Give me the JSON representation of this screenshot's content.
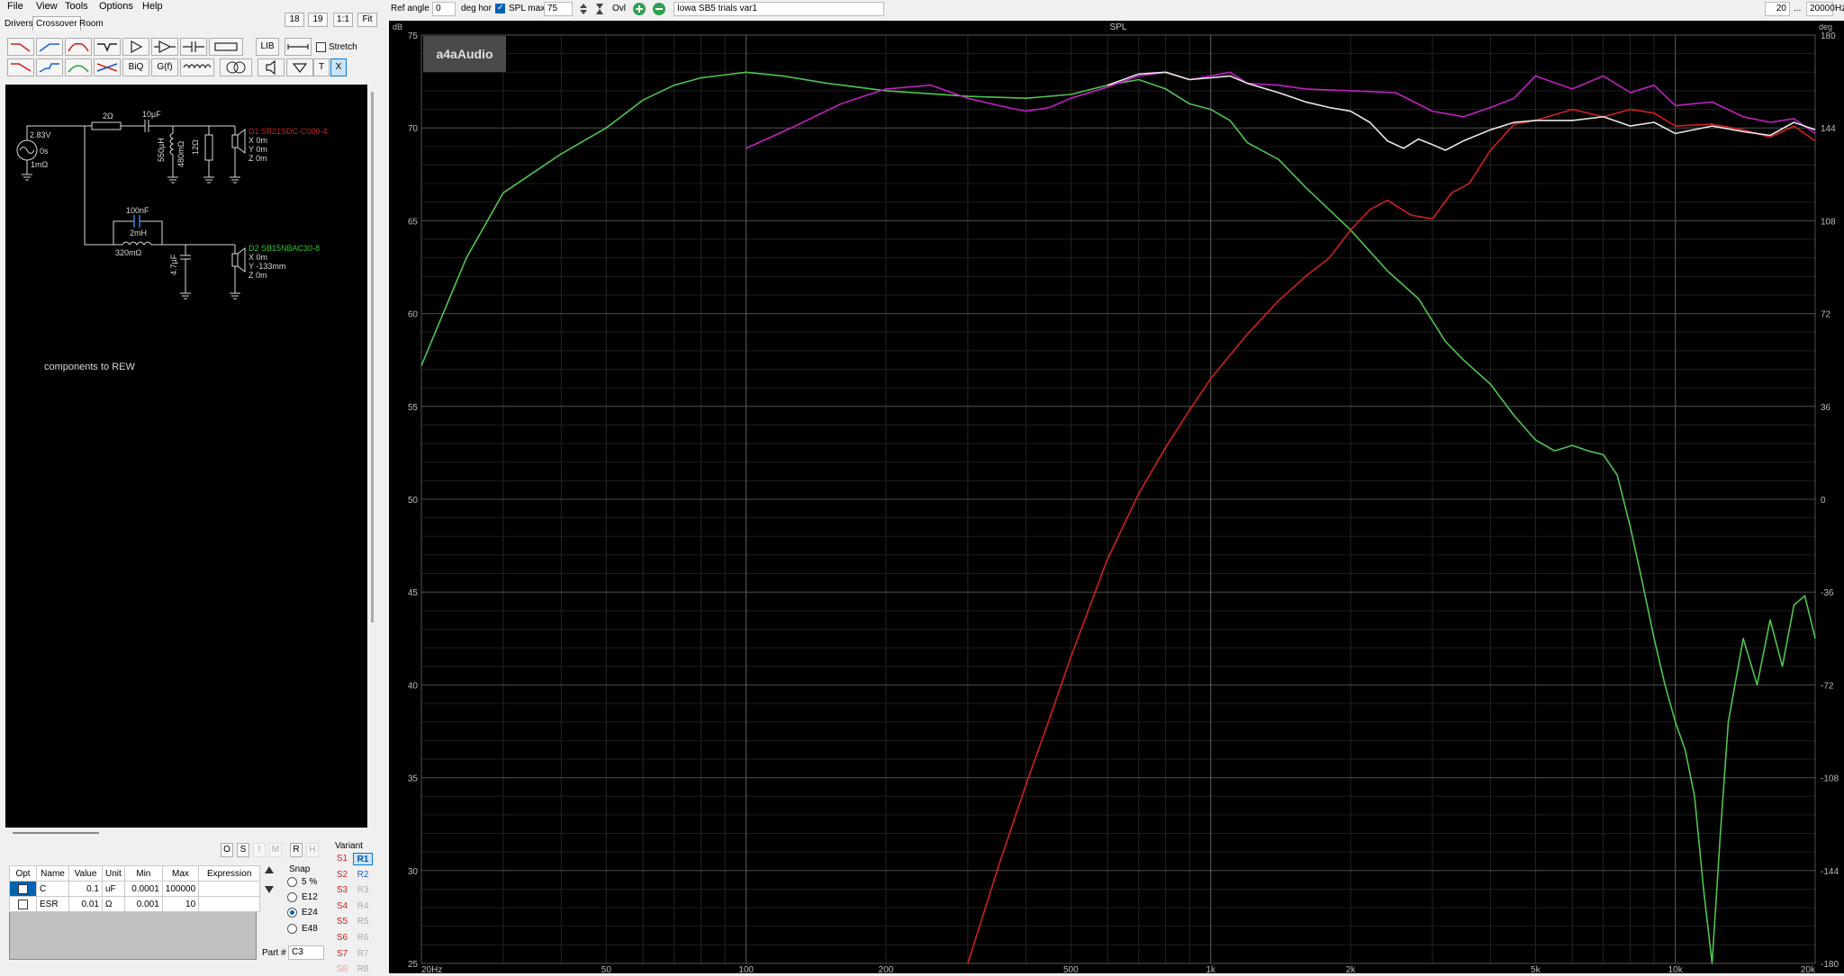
{
  "menu": [
    "File",
    "View",
    "Tools",
    "Options",
    "Help"
  ],
  "tabs": [
    "Drivers",
    "Crossover",
    "Room"
  ],
  "view_buttons": [
    "18",
    "19",
    "1:1",
    "Fit"
  ],
  "toolbar": {
    "lib": "LIB",
    "biq": "BiQ",
    "gf": "G(f)",
    "t": "T",
    "x": "X",
    "stretch_label": "Stretch"
  },
  "schematic": {
    "source_voltage": "2.83V",
    "source_delay": "0s",
    "source_resistance": "1mΩ",
    "r_series": "2Ω",
    "c_series": "10µF",
    "l_shunt": "550µH",
    "l_shunt_res": "480mΩ",
    "r_shunt": "12Ω",
    "d1_name": "D1 SB21SDC-C000-4",
    "d1_x": "X 0m",
    "d1_y": "Y 0m",
    "d1_z": "Z 0m",
    "c_parallel": "100nF",
    "l_series2": "2mH",
    "l_series2_res": "320mΩ",
    "c_shunt2": "4.7µF",
    "d2_name": "D2 SB15NBAC30-8",
    "d2_x": "X 0m",
    "d2_y": "Y -133mm",
    "d2_z": "Z 0m",
    "note": "components to REW"
  },
  "ops_buttons": [
    "O",
    "S",
    "I",
    "M",
    "R",
    "H"
  ],
  "parts_table": {
    "headers": [
      "Opt",
      "Name",
      "Value",
      "Unit",
      "Min",
      "Max",
      "Expression"
    ],
    "rows": [
      {
        "name": "C",
        "value": "0.1",
        "unit": "uF",
        "min": "0.0001",
        "max": "100000",
        "expr": ""
      },
      {
        "name": "ESR",
        "value": "0.01",
        "unit": "Ω",
        "min": "0.001",
        "max": "10",
        "expr": ""
      }
    ]
  },
  "snap": {
    "label": "Snap",
    "options": [
      "5 %",
      "E12",
      "E24",
      "E48"
    ],
    "selected": "E24"
  },
  "part_label": "Part #",
  "part_value": "C3",
  "variant": {
    "label": "Variant",
    "s": [
      "S1",
      "S2",
      "S3",
      "S4",
      "S5",
      "S6",
      "S7",
      "S8"
    ],
    "r": [
      "R1",
      "R2",
      "R3",
      "R4",
      "R5",
      "R6",
      "R7",
      "R8"
    ]
  },
  "topbar": {
    "ref_angle_label": "Ref angle",
    "ref_angle_value": "0",
    "deg_hor": "deg hor",
    "spl_max_label": "SPL max",
    "spl_max_value": "75",
    "ovl": "Ovl",
    "project_name": "Iowa SB5 trials var1",
    "f_min": "20",
    "ellipsis": "...",
    "f_max": "20000",
    "hz": "Hz"
  },
  "colors": {
    "green": "#4fc44f",
    "red": "#d21f1f",
    "magenta": "#c31fc3",
    "white": "#e8e8e8",
    "grid": "#3a3a3a"
  },
  "chart_data": {
    "type": "line",
    "title": "SPL",
    "xlabel": "",
    "ylabel": "dB",
    "y2label": "deg",
    "x_scale": "log",
    "xlim": [
      20,
      20000
    ],
    "ylim": [
      25,
      75
    ],
    "y2lim": [
      -180,
      180
    ],
    "x_ticks": [
      {
        "v": 20,
        "label": "20Hz"
      },
      {
        "v": 50,
        "label": "50"
      },
      {
        "v": 100,
        "label": "100"
      },
      {
        "v": 200,
        "label": "200"
      },
      {
        "v": 500,
        "label": "500"
      },
      {
        "v": 1000,
        "label": "1k"
      },
      {
        "v": 2000,
        "label": "2k"
      },
      {
        "v": 5000,
        "label": "5k"
      },
      {
        "v": 10000,
        "label": "10k"
      },
      {
        "v": 20000,
        "label": "20k"
      }
    ],
    "y_ticks": [
      25,
      30,
      35,
      40,
      45,
      50,
      55,
      60,
      65,
      70,
      75
    ],
    "y2_ticks": [
      -180,
      -144,
      -108,
      -72,
      -36,
      0,
      36,
      72,
      108,
      144,
      180
    ],
    "grid": true,
    "logo": "a4aAudio",
    "series": [
      {
        "color": "#4fc44f",
        "points": [
          [
            20,
            57.2
          ],
          [
            25,
            63
          ],
          [
            30,
            66.5
          ],
          [
            40,
            68.6
          ],
          [
            50,
            70
          ],
          [
            60,
            71.5
          ],
          [
            70,
            72.3
          ],
          [
            80,
            72.7
          ],
          [
            100,
            73
          ],
          [
            120,
            72.8
          ],
          [
            150,
            72.4
          ],
          [
            200,
            72
          ],
          [
            300,
            71.7
          ],
          [
            400,
            71.6
          ],
          [
            500,
            71.8
          ],
          [
            600,
            72.3
          ],
          [
            700,
            72.6
          ],
          [
            800,
            72.1
          ],
          [
            900,
            71.3
          ],
          [
            1000,
            71
          ],
          [
            1100,
            70.4
          ],
          [
            1200,
            69.2
          ],
          [
            1400,
            68.3
          ],
          [
            1600,
            66.8
          ],
          [
            2000,
            64.5
          ],
          [
            2400,
            62.3
          ],
          [
            2800,
            60.8
          ],
          [
            3200,
            58.5
          ],
          [
            3500,
            57.5
          ],
          [
            4000,
            56.2
          ],
          [
            4500,
            54.5
          ],
          [
            5000,
            53.2
          ],
          [
            5500,
            52.6
          ],
          [
            6000,
            52.9
          ],
          [
            6500,
            52.6
          ],
          [
            7000,
            52.4
          ],
          [
            7500,
            51.3
          ],
          [
            8000,
            48.5
          ],
          [
            8500,
            45.5
          ],
          [
            9000,
            42.5
          ],
          [
            9500,
            40
          ],
          [
            10000,
            38
          ],
          [
            10500,
            36.5
          ],
          [
            11000,
            34
          ],
          [
            11500,
            29
          ],
          [
            12000,
            25
          ],
          [
            12500,
            32
          ],
          [
            13000,
            38
          ],
          [
            14000,
            42.5
          ],
          [
            15000,
            40
          ],
          [
            16000,
            43.5
          ],
          [
            17000,
            41
          ],
          [
            18000,
            44.3
          ],
          [
            19000,
            44.8
          ],
          [
            20000,
            42.5
          ]
        ]
      },
      {
        "color": "#d21f1f",
        "points": [
          [
            300,
            25
          ],
          [
            350,
            30.3
          ],
          [
            400,
            34.6
          ],
          [
            450,
            38.2
          ],
          [
            500,
            41.5
          ],
          [
            600,
            46.8
          ],
          [
            700,
            50.3
          ],
          [
            800,
            52.8
          ],
          [
            900,
            54.8
          ],
          [
            1000,
            56.5
          ],
          [
            1200,
            58.9
          ],
          [
            1400,
            60.7
          ],
          [
            1600,
            62
          ],
          [
            1800,
            63
          ],
          [
            2000,
            64.5
          ],
          [
            2200,
            65.6
          ],
          [
            2400,
            66.1
          ],
          [
            2700,
            65.3
          ],
          [
            3000,
            65.1
          ],
          [
            3300,
            66.5
          ],
          [
            3600,
            67
          ],
          [
            4000,
            68.8
          ],
          [
            4500,
            70.2
          ],
          [
            5000,
            70.4
          ],
          [
            6000,
            71
          ],
          [
            7000,
            70.6
          ],
          [
            8000,
            71
          ],
          [
            9000,
            70.8
          ],
          [
            10000,
            70.1
          ],
          [
            12000,
            70.2
          ],
          [
            14000,
            69.9
          ],
          [
            16000,
            69.5
          ],
          [
            18000,
            70.1
          ],
          [
            20000,
            69.3
          ]
        ]
      },
      {
        "color": "#c31fc3",
        "points": [
          [
            100,
            68.9
          ],
          [
            130,
            70.2
          ],
          [
            160,
            71.3
          ],
          [
            200,
            72.1
          ],
          [
            250,
            72.3
          ],
          [
            300,
            71.6
          ],
          [
            350,
            71.2
          ],
          [
            400,
            70.9
          ],
          [
            450,
            71.1
          ],
          [
            500,
            71.6
          ],
          [
            600,
            72.2
          ],
          [
            700,
            72.8
          ],
          [
            800,
            73
          ],
          [
            900,
            72.6
          ],
          [
            1000,
            72.8
          ],
          [
            1100,
            73
          ],
          [
            1200,
            72.4
          ],
          [
            1400,
            72.3
          ],
          [
            1600,
            72.1
          ],
          [
            2000,
            72
          ],
          [
            2500,
            71.9
          ],
          [
            3000,
            70.9
          ],
          [
            3500,
            70.6
          ],
          [
            4000,
            71.1
          ],
          [
            4500,
            71.6
          ],
          [
            5000,
            72.8
          ],
          [
            6000,
            72.1
          ],
          [
            7000,
            72.8
          ],
          [
            8000,
            71.9
          ],
          [
            9000,
            72.3
          ],
          [
            10000,
            71.2
          ],
          [
            12000,
            71.4
          ],
          [
            14000,
            70.6
          ],
          [
            16000,
            70.3
          ],
          [
            18000,
            70.5
          ],
          [
            20000,
            69.7
          ]
        ]
      },
      {
        "color": "#e8e8e8",
        "points": [
          [
            600,
            72.3
          ],
          [
            700,
            72.9
          ],
          [
            800,
            73
          ],
          [
            900,
            72.6
          ],
          [
            1000,
            72.7
          ],
          [
            1100,
            72.8
          ],
          [
            1200,
            72.4
          ],
          [
            1400,
            71.9
          ],
          [
            1600,
            71.4
          ],
          [
            1800,
            71.1
          ],
          [
            2000,
            70.9
          ],
          [
            2200,
            70.3
          ],
          [
            2400,
            69.3
          ],
          [
            2600,
            68.9
          ],
          [
            2800,
            69.4
          ],
          [
            3000,
            69.1
          ],
          [
            3200,
            68.8
          ],
          [
            3500,
            69.3
          ],
          [
            4000,
            69.9
          ],
          [
            4500,
            70.3
          ],
          [
            5000,
            70.4
          ],
          [
            6000,
            70.4
          ],
          [
            7000,
            70.6
          ],
          [
            8000,
            70.1
          ],
          [
            9000,
            70.3
          ],
          [
            10000,
            69.7
          ],
          [
            12000,
            70.1
          ],
          [
            14000,
            69.8
          ],
          [
            16000,
            69.6
          ],
          [
            18000,
            70.3
          ],
          [
            20000,
            69.9
          ]
        ]
      }
    ]
  }
}
